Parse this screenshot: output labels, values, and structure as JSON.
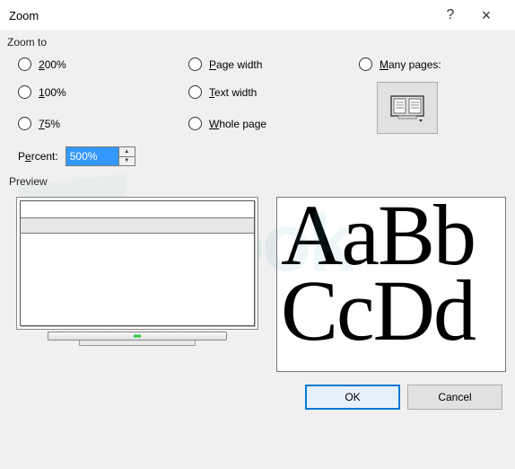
{
  "title": "Zoom",
  "help_symbol": "?",
  "close_symbol": "×",
  "zoom_to": {
    "label": "Zoom to",
    "options": {
      "p200": "200%",
      "p100": "100%",
      "p75": "75%",
      "page_width": "Page width",
      "text_width": "Text width",
      "whole_page": "Whole page",
      "many_pages": "Many pages:"
    }
  },
  "percent": {
    "label": "Percent:",
    "value": "500%"
  },
  "preview": {
    "label": "Preview",
    "sample_line1": "AaBb",
    "sample_line2": "CcDd"
  },
  "buttons": {
    "ok": "OK",
    "cancel": "Cancel"
  }
}
